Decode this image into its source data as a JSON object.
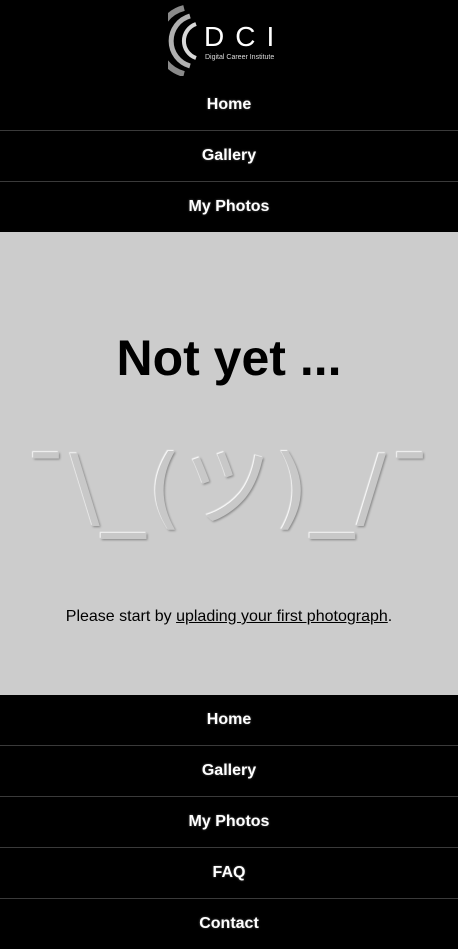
{
  "logo": {
    "letters": "DCI",
    "tagline": "Digital Career Institute"
  },
  "top_nav": [
    {
      "label": "Home"
    },
    {
      "label": "Gallery"
    },
    {
      "label": "My Photos"
    }
  ],
  "main": {
    "heading": "Not yet ...",
    "shrug": "¯\\_(ツ)_/¯",
    "message_prefix": "Please start by ",
    "message_link": "uplading your first photograph",
    "message_suffix": "."
  },
  "footer_nav": [
    {
      "label": "Home"
    },
    {
      "label": "Gallery"
    },
    {
      "label": "My Photos"
    },
    {
      "label": "FAQ"
    },
    {
      "label": "Contact"
    }
  ]
}
